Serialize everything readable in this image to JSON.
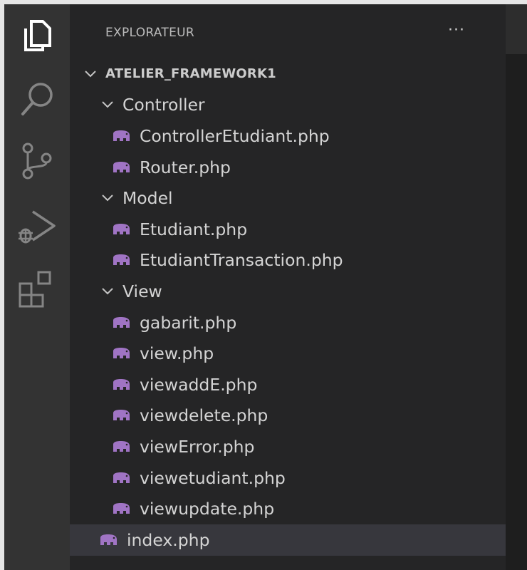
{
  "explorer": {
    "title": "EXPLORATEUR",
    "more_label": "···"
  },
  "activity_bar": [
    {
      "name": "explorer-icon"
    },
    {
      "name": "search-icon"
    },
    {
      "name": "source-control-icon"
    },
    {
      "name": "run-debug-icon"
    },
    {
      "name": "extensions-icon"
    }
  ],
  "tree": {
    "root": "ATELIER_FRAMEWORK1",
    "folders": [
      {
        "name": "Controller",
        "files": [
          "ControllerEtudiant.php",
          "Router.php"
        ]
      },
      {
        "name": "Model",
        "files": [
          "Etudiant.php",
          "EtudiantTransaction.php"
        ]
      },
      {
        "name": "View",
        "files": [
          "gabarit.php",
          "view.php",
          "viewaddE.php",
          "viewdelete.php",
          "viewError.php",
          "viewetudiant.php",
          "viewupdate.php"
        ]
      }
    ],
    "root_files": [
      "index.php"
    ],
    "selected": "index.php"
  },
  "colors": {
    "php_icon": "#a074c4",
    "sidebar_bg": "#252526",
    "activity_bg": "#333333",
    "selected_bg": "#37373d"
  }
}
